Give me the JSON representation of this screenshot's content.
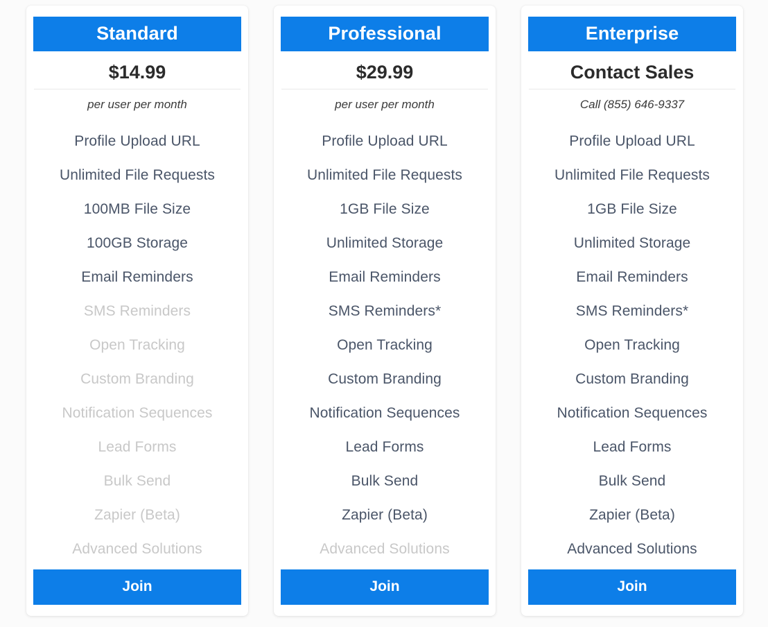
{
  "plans": [
    {
      "name": "Standard",
      "price": "$14.99",
      "subtitle": "per user per month",
      "cta_label": "Join",
      "features": [
        {
          "label": "Profile Upload URL",
          "enabled": true
        },
        {
          "label": "Unlimited File Requests",
          "enabled": true
        },
        {
          "label": "100MB File Size",
          "enabled": true
        },
        {
          "label": "100GB Storage",
          "enabled": true
        },
        {
          "label": "Email Reminders",
          "enabled": true
        },
        {
          "label": "SMS Reminders",
          "enabled": false
        },
        {
          "label": "Open Tracking",
          "enabled": false
        },
        {
          "label": "Custom Branding",
          "enabled": false
        },
        {
          "label": "Notification Sequences",
          "enabled": false
        },
        {
          "label": "Lead Forms",
          "enabled": false
        },
        {
          "label": "Bulk Send",
          "enabled": false
        },
        {
          "label": "Zapier (Beta)",
          "enabled": false
        },
        {
          "label": "Advanced Solutions",
          "enabled": false
        }
      ]
    },
    {
      "name": "Professional",
      "price": "$29.99",
      "subtitle": "per user per month",
      "cta_label": "Join",
      "features": [
        {
          "label": "Profile Upload URL",
          "enabled": true
        },
        {
          "label": "Unlimited File Requests",
          "enabled": true
        },
        {
          "label": "1GB File Size",
          "enabled": true
        },
        {
          "label": "Unlimited Storage",
          "enabled": true
        },
        {
          "label": "Email Reminders",
          "enabled": true
        },
        {
          "label": "SMS Reminders*",
          "enabled": true
        },
        {
          "label": "Open Tracking",
          "enabled": true
        },
        {
          "label": "Custom Branding",
          "enabled": true
        },
        {
          "label": "Notification Sequences",
          "enabled": true
        },
        {
          "label": "Lead Forms",
          "enabled": true
        },
        {
          "label": "Bulk Send",
          "enabled": true
        },
        {
          "label": "Zapier (Beta)",
          "enabled": true
        },
        {
          "label": "Advanced Solutions",
          "enabled": false
        }
      ]
    },
    {
      "name": "Enterprise",
      "price": "Contact Sales",
      "subtitle": "Call (855) 646-9337",
      "cta_label": "Join",
      "features": [
        {
          "label": "Profile Upload URL",
          "enabled": true
        },
        {
          "label": "Unlimited File Requests",
          "enabled": true
        },
        {
          "label": "1GB File Size",
          "enabled": true
        },
        {
          "label": "Unlimited Storage",
          "enabled": true
        },
        {
          "label": "Email Reminders",
          "enabled": true
        },
        {
          "label": "SMS Reminders*",
          "enabled": true
        },
        {
          "label": "Open Tracking",
          "enabled": true
        },
        {
          "label": "Custom Branding",
          "enabled": true
        },
        {
          "label": "Notification Sequences",
          "enabled": true
        },
        {
          "label": "Lead Forms",
          "enabled": true
        },
        {
          "label": "Bulk Send",
          "enabled": true
        },
        {
          "label": "Zapier (Beta)",
          "enabled": true
        },
        {
          "label": "Advanced Solutions",
          "enabled": true
        }
      ]
    }
  ],
  "colors": {
    "accent": "#0d7ee8",
    "page_background": "#fbfbfb",
    "card_background": "#ffffff",
    "feature_enabled": "#4a5568",
    "feature_disabled": "#c8c8c8",
    "price_text": "#2b2b2b",
    "divider": "#e9e9e9"
  }
}
